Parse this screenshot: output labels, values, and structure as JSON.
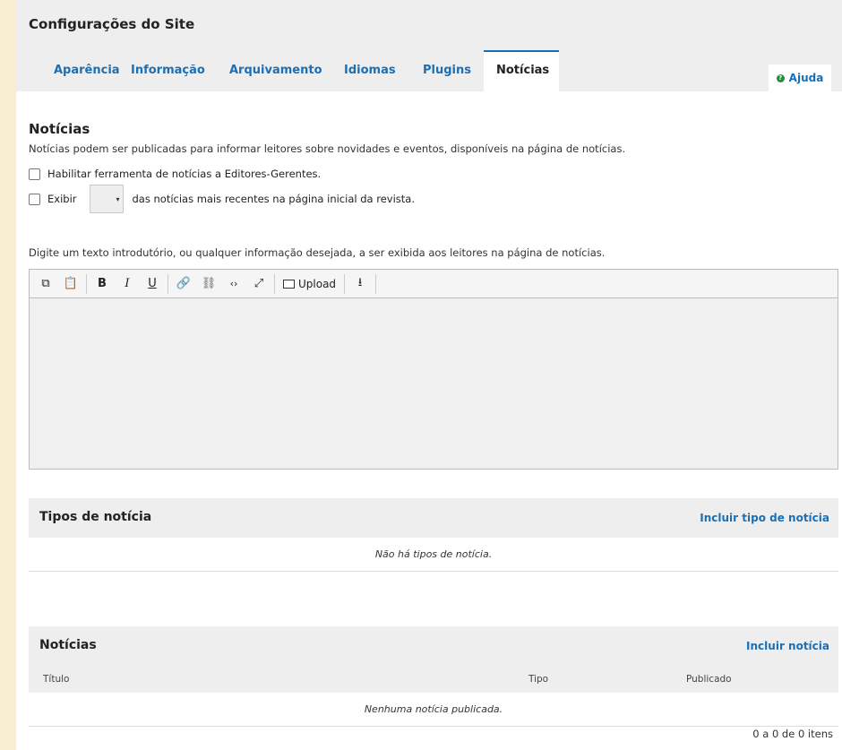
{
  "header": {
    "title": "Configurações do Site",
    "tabs": [
      {
        "label": "Aparência"
      },
      {
        "label": "Informação"
      },
      {
        "label": "Arquivamento"
      },
      {
        "label": "Idiomas"
      },
      {
        "label": "Plugins"
      },
      {
        "label": "Notícias"
      }
    ],
    "active_tab": "Notícias",
    "help_label": "Ajuda"
  },
  "news_settings": {
    "title": "Notícias",
    "description": "Notícias podem ser publicadas para informar leitores sobre novidades e eventos, disponíveis na página de notícias.",
    "enable_label": "Habilitar ferramenta de notícias a Editores-Gerentes.",
    "display_prefix": "Exibir",
    "display_suffix": "das notícias mais recentes na página inicial da revista.",
    "intro_label": "Digite um texto introdutório, ou qualquer informação desejada, a ser exibida aos leitores na página de notícias."
  },
  "editor": {
    "upload_label": "Upload",
    "icons": [
      "copy-icon",
      "paste-icon",
      "bold-icon",
      "italic-icon",
      "underline-icon",
      "link-icon",
      "unlink-icon",
      "code-icon",
      "fullscreen-icon",
      "image-icon",
      "import-icon"
    ]
  },
  "news_types_grid": {
    "title": "Tipos de notícia",
    "action": "Incluir tipo de notícia",
    "empty": "Não há tipos de notícia."
  },
  "news_grid": {
    "title": "Notícias",
    "action": "Incluir notícia",
    "columns": [
      "Título",
      "Tipo",
      "Publicado"
    ],
    "empty": "Nenhuma notícia publicada.",
    "pager": "0 a 0 de 0 itens"
  },
  "colors": {
    "background": "#f6eecf",
    "link": "#1a6fb5",
    "help_dot": "#1e8f3a",
    "header": "#eeeeee"
  }
}
